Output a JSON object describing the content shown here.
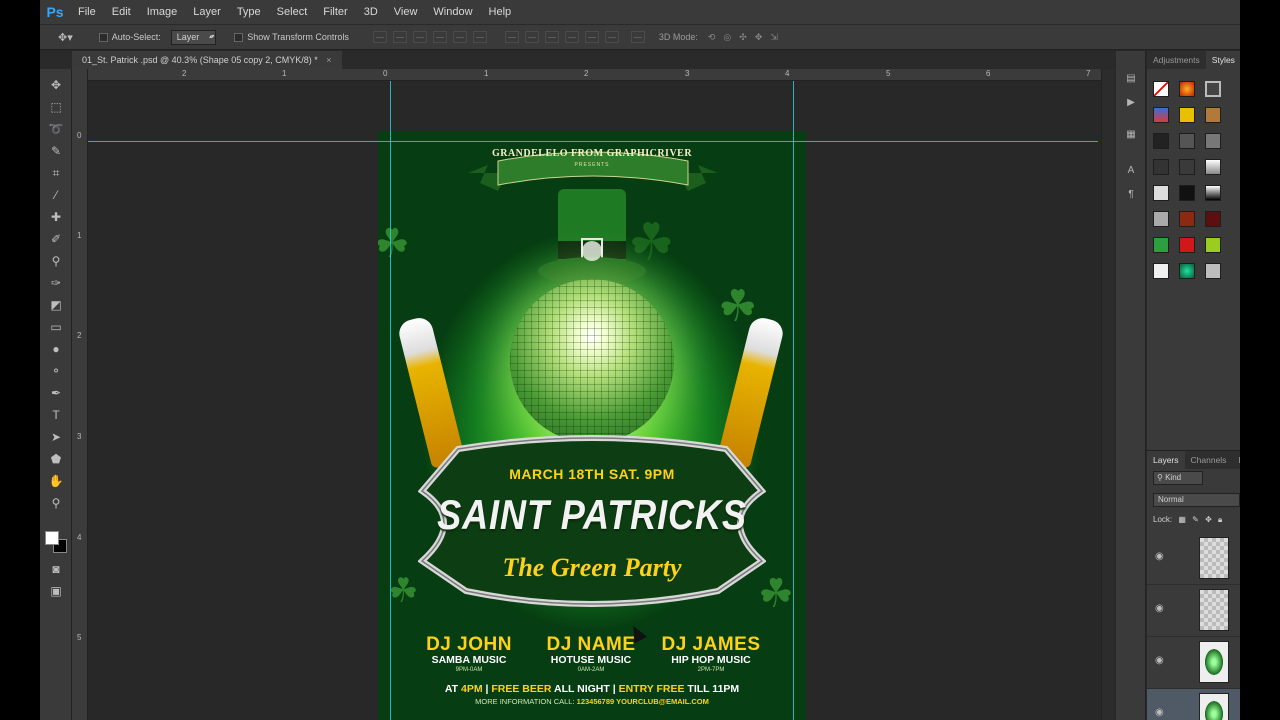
{
  "app": {
    "logo": "Ps"
  },
  "menu": [
    "File",
    "Edit",
    "Image",
    "Layer",
    "Type",
    "Select",
    "Filter",
    "3D",
    "View",
    "Window",
    "Help"
  ],
  "options": {
    "auto_select_label": "Auto-Select:",
    "auto_select_value": "Layer",
    "show_transform_label": "Show Transform Controls",
    "mode_3d_label": "3D Mode:"
  },
  "document": {
    "tab_title": "01_St. Patrick .psd @ 40.3% (Shape 05 copy 2, CMYK/8) *",
    "close": "×"
  },
  "rulers": {
    "h": [
      "2",
      "1",
      "0",
      "1",
      "2",
      "3",
      "4",
      "5",
      "6",
      "7"
    ],
    "v": [
      "0",
      "1",
      "2",
      "3",
      "4",
      "5"
    ]
  },
  "flyer": {
    "ribbon_text": "GRANDELELO FROM GRAPHICRIVER",
    "ribbon_sub": "PRESENTS",
    "date": "MARCH 18TH SAT. 9PM",
    "title": "SAINT PATRICKS",
    "subtitle": "The Green Party",
    "djs": [
      {
        "name": "DJ JOHN",
        "genre": "SAMBA MUSIC",
        "time": "9PM-0AM"
      },
      {
        "name": "DJ NAME",
        "genre": "HOTUSE MUSIC",
        "time": "0AM-2AM"
      },
      {
        "name": "DJ JAMES",
        "genre": "HIP HOP MUSIC",
        "time": "2PM-7PM"
      }
    ],
    "footer_line1": {
      "a": "AT ",
      "b": "4PM",
      "c": " | ",
      "d": "FREE BEER",
      "e": " ALL NIGHT | ",
      "f": "ENTRY FREE",
      "g": " TILL 11PM"
    },
    "footer_line2": {
      "a": "MORE INFORMATION CALL: ",
      "b": "123456789 YOURCLUB@EMAIL.COM"
    }
  },
  "panels": {
    "top_tabs": [
      "Adjustments",
      "Styles"
    ],
    "layers_tabs": [
      "Layers",
      "Channels",
      "P"
    ],
    "kind": "Kind",
    "blend_mode": "Normal",
    "lock_label": "Lock:"
  },
  "colors": {
    "accent_guide": "#29d4e0",
    "flyer_yellow": "#ffd21a",
    "ps_blue": "#31a8ff"
  }
}
